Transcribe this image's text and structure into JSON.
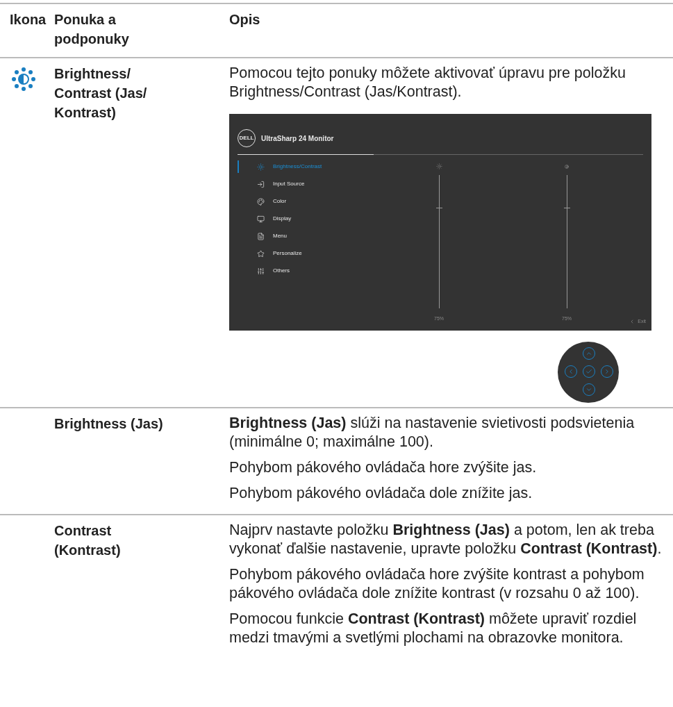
{
  "columns": [
    "Ikona",
    "Ponuka a podponuky",
    "Opis"
  ],
  "rows": [
    {
      "kind": "main",
      "menu": "Brightness/ Contrast (Jas/ Kontrast)",
      "paragraphs": [
        "Pomocou tejto ponuky môžete aktivovať úpravu pre položku Brightness/Contrast (Jas/Kontrast)."
      ],
      "osd": {
        "logo": "DELL",
        "title": "UltraSharp 24 Monitor",
        "menu_items": [
          {
            "label": "Brightness/Contrast",
            "selected": true
          },
          {
            "label": "Input Source",
            "selected": false
          },
          {
            "label": "Color",
            "selected": false
          },
          {
            "label": "Display",
            "selected": false
          },
          {
            "label": "Menu",
            "selected": false
          },
          {
            "label": "Personalize",
            "selected": false
          },
          {
            "label": "Others",
            "selected": false
          }
        ],
        "sliders": [
          {
            "kind": "brightness",
            "level": 0.75,
            "reading": "75%"
          },
          {
            "kind": "contrast",
            "level": 0.75,
            "reading": "75%"
          }
        ],
        "exit": "Exit"
      }
    },
    {
      "kind": "sub",
      "menu": "Brightness (Jas)",
      "paragraphs": [
        "**Brightness (Jas)** slúži na nastavenie svietivosti podsvietenia (minimálne 0; maximálne 100).",
        "Pohybom pákového ovládača hore zvýšite jas.",
        "Pohybom pákového ovládača dole znížite jas."
      ]
    },
    {
      "kind": "sub",
      "menu": "Contrast (Kontrast)",
      "paragraphs": [
        "Najprv nastavte položku **Brightness (Jas)** a potom, len ak treba vykonať ďalšie nastavenie, upravte položku **Contrast (Kontrast)**.",
        "Pohybom pákového ovládača hore zvýšite kontrast a pohybom pákového ovládača dole znížite kontrast (v rozsahu 0 až 100).",
        "Pomocou funkcie **Contrast (Kontrast)** môžete upraviť rozdiel medzi tmavými a svetlými plochami na obrazovke monitora."
      ]
    }
  ]
}
